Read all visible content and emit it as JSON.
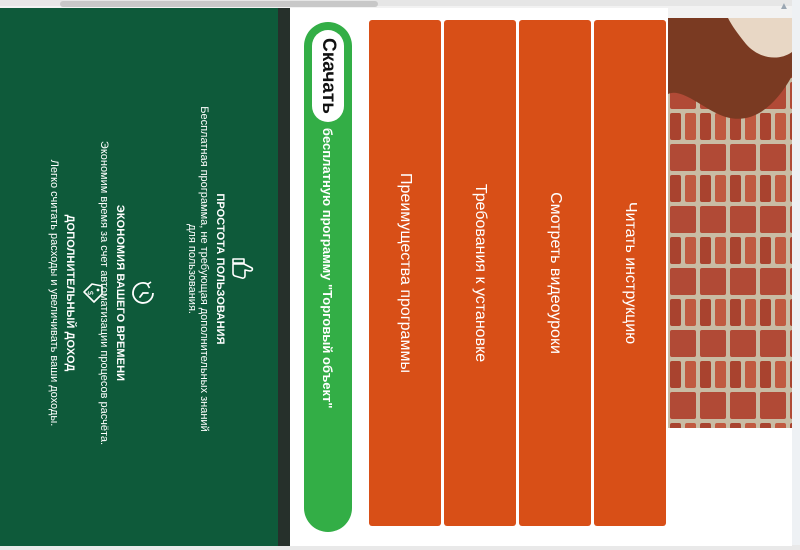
{
  "features": [
    {
      "icon": "thumbs-up-icon",
      "title": "ПРОСТОТА ПОЛЬЗОВАНИЯ",
      "text": "Бесплатная программа, не требующая дополнительных знаний для пользования."
    },
    {
      "icon": "clock-icon",
      "title": "ЭКОНОМИЯ ВАШЕГО ВРЕМЕНИ",
      "text": "Экономим время за счет автоматизации процесов расчёта."
    },
    {
      "icon": "money-tag-icon",
      "title": "ДОПОЛНИТЕЛЬНЫЙ ДОХОД",
      "text": "Легко считать расходы и увеличивать ваши доходы."
    }
  ],
  "download": {
    "label": "Скачать",
    "text": "бесплатную программу \"Торговый объект\""
  },
  "menu": [
    {
      "label": "Преимущества программы"
    },
    {
      "label": "Требования к установке"
    },
    {
      "label": "Смотреть видеоуроки"
    },
    {
      "label": "Читать инструкцию"
    }
  ],
  "colors": {
    "green_panel": "#0e5a3a",
    "download_green": "#33ae46",
    "tile_orange": "#d84f17"
  }
}
